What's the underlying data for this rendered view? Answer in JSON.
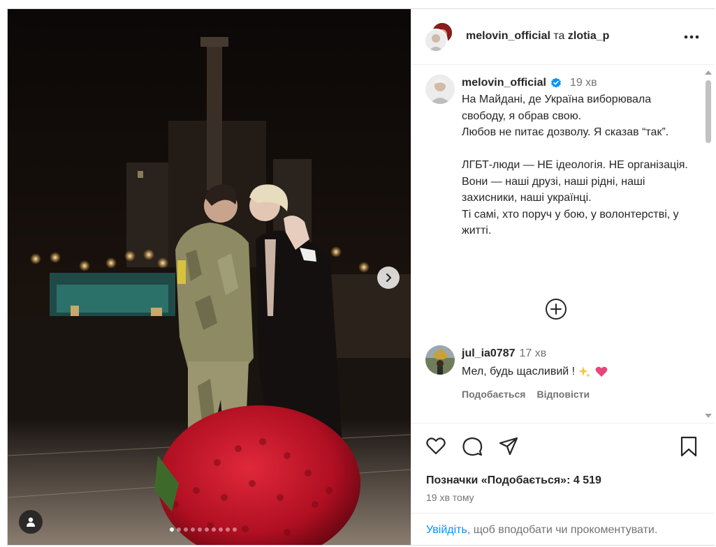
{
  "post": {
    "header": {
      "author": "melovin_official",
      "connector": "та",
      "coauthor": "zlotia_p"
    },
    "caption": {
      "author": "melovin_official",
      "time": "19 хв",
      "text": "На Майдані, де Україна виборювала свободу, я обрав свою.\nЛюбов не питає дозволу. Я сказав “так”.\n\nЛГБТ-люди — НЕ ідеологія. НЕ організація.\nВони — наші друзі, наші рідні, наші захисники, наші українці.\nТі самі, хто поруч у бою, у волонтерстві, у житті."
    },
    "comments": [
      {
        "username": "jul_ia0787",
        "time": "17 хв",
        "text": "Мел, будь щасливий !",
        "emojis": [
          "sparkles",
          "pink-heart"
        ],
        "like_label": "Подобається",
        "reply_label": "Відповісти"
      }
    ],
    "likes_label": "Позначки «Подобається»: 4 519",
    "posted_time": "19 хв тому",
    "login_prompt": {
      "link": "Увійдіть",
      "rest": ", щоб вподобати чи прокоментувати."
    },
    "carousel": {
      "total_dots": 10,
      "active_index": 0
    },
    "icons": {
      "more": "more-horizontal-icon",
      "verified": "verified-badge-icon",
      "load_more": "plus-circle-icon",
      "like": "heart-icon",
      "comment": "comment-icon",
      "share": "share-icon",
      "save": "bookmark-icon",
      "next": "chevron-right-icon",
      "tags": "user-tag-icon"
    },
    "colors": {
      "link": "#0095f6",
      "verified": "#0095f6",
      "muted": "#737373",
      "text": "#262626"
    }
  }
}
